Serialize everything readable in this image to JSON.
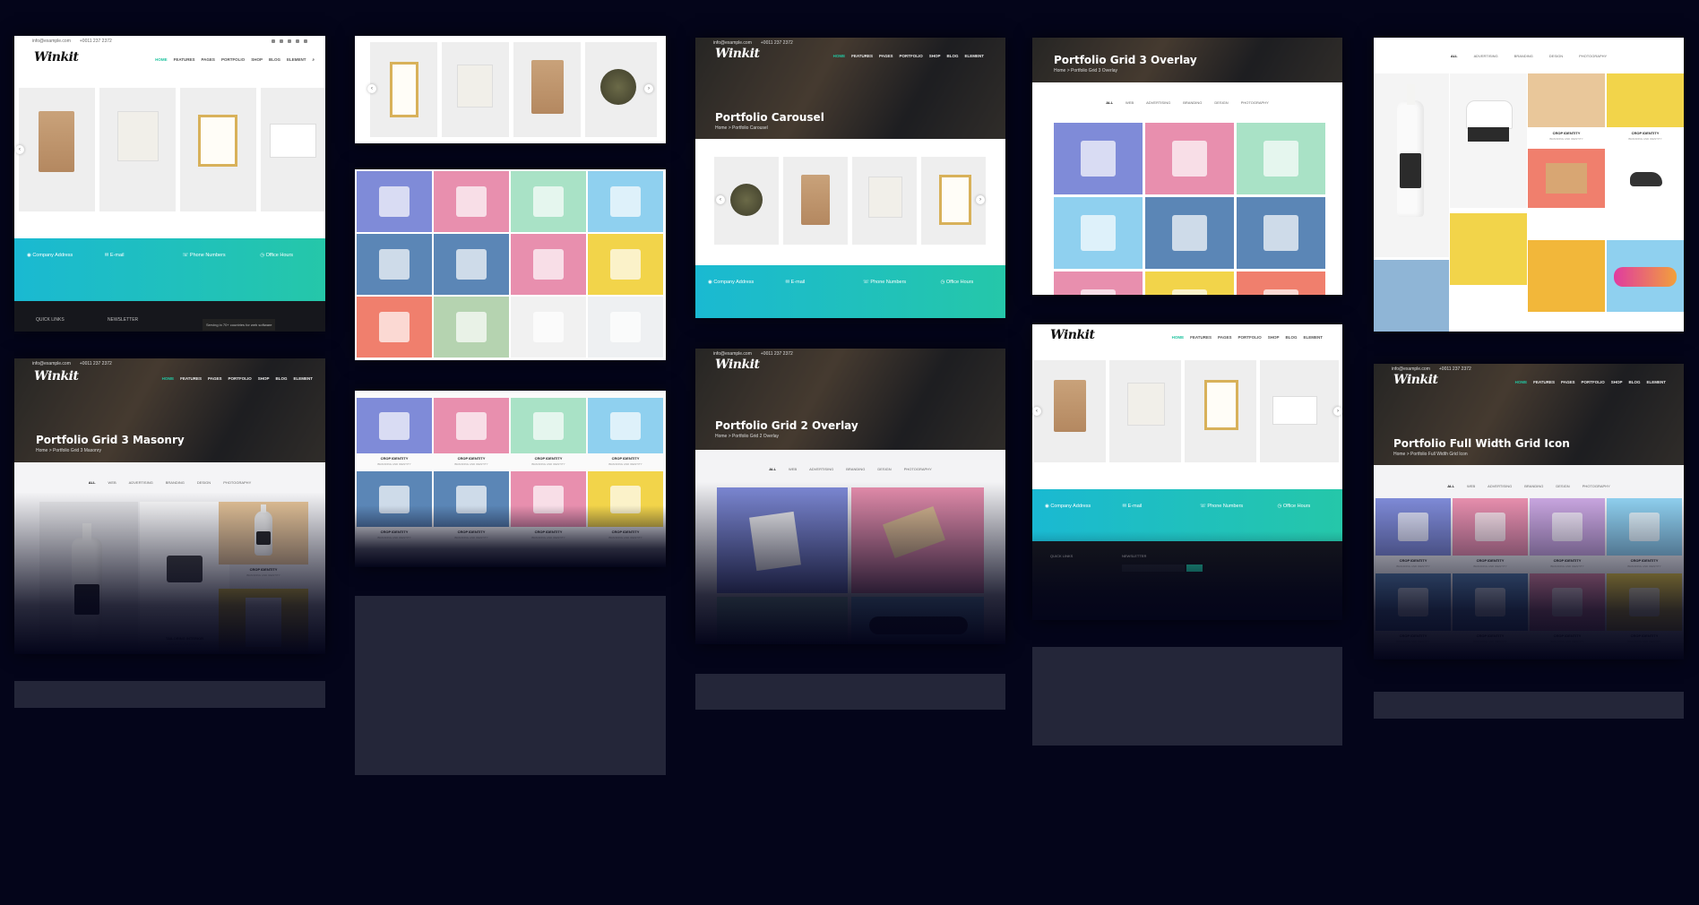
{
  "brand": {
    "logo": "Winkit",
    "accent": "#23c4a0",
    "teal": "#1ab9d2",
    "background": "#04051a"
  },
  "topbar": {
    "email": "info@example.com",
    "phone": "+0011 237 2372"
  },
  "nav": [
    "HOME",
    "FEATURES",
    "PAGES",
    "PORTFOLIO",
    "SHOP",
    "BLOG",
    "ELEMENT"
  ],
  "filters": [
    "ALL",
    "WEB",
    "ADVERTISING",
    "BRANDING",
    "DESIGN",
    "PHOTOGRAPHY"
  ],
  "pages": {
    "carousel": {
      "title": "Portfolio Carousel",
      "crumb": "Home > Portfolio Carousel"
    },
    "grid3_masonry": {
      "title": "Portfolio Grid 3 Masonry",
      "crumb": "Home > Portfolio Grid 3 Masonry"
    },
    "grid2_overlay": {
      "title": "Portfolio Grid 2 Overlay",
      "crumb": "Home > Portfolio Grid 2 Overlay"
    },
    "grid3_overlay": {
      "title": "Portfolio Grid 3 Overlay",
      "crumb": "Home > Portfolio Grid 3 Overlay"
    },
    "fullwidth_icon": {
      "title": "Portfolio Full Width Grid Icon",
      "crumb": "Home > Portfolio Full Width Grid Icon"
    }
  },
  "footer": {
    "items": [
      {
        "label": "Company Address",
        "icon": "map-pin-icon"
      },
      {
        "label": "E-mail",
        "icon": "mail-icon"
      },
      {
        "label": "Phone Numbers",
        "icon": "phone-icon"
      },
      {
        "label": "Office Hours",
        "icon": "clock-icon"
      }
    ],
    "quick_links": "QUICK LINKS",
    "newsletter": "NEWSLETTER",
    "serving": "Serving in 70+ countries for web software"
  },
  "captions": {
    "crop": "CROP IDENTITY",
    "crop_sub": "BRANDING AND IDENTITY",
    "tailoring": "TAILORING INTERIOR",
    "tailoring_sub": "BRANDING AND IDENTITY"
  },
  "colors": {
    "blue": "#7f8bd8",
    "pink": "#e88fae",
    "mint": "#a9e2c6",
    "sky": "#8fd0ef",
    "steel": "#5b86b6",
    "yellow": "#f2d44a",
    "coral": "#f07f6d",
    "sage": "#b5d3b0",
    "lavender": "#c9a6e0"
  }
}
